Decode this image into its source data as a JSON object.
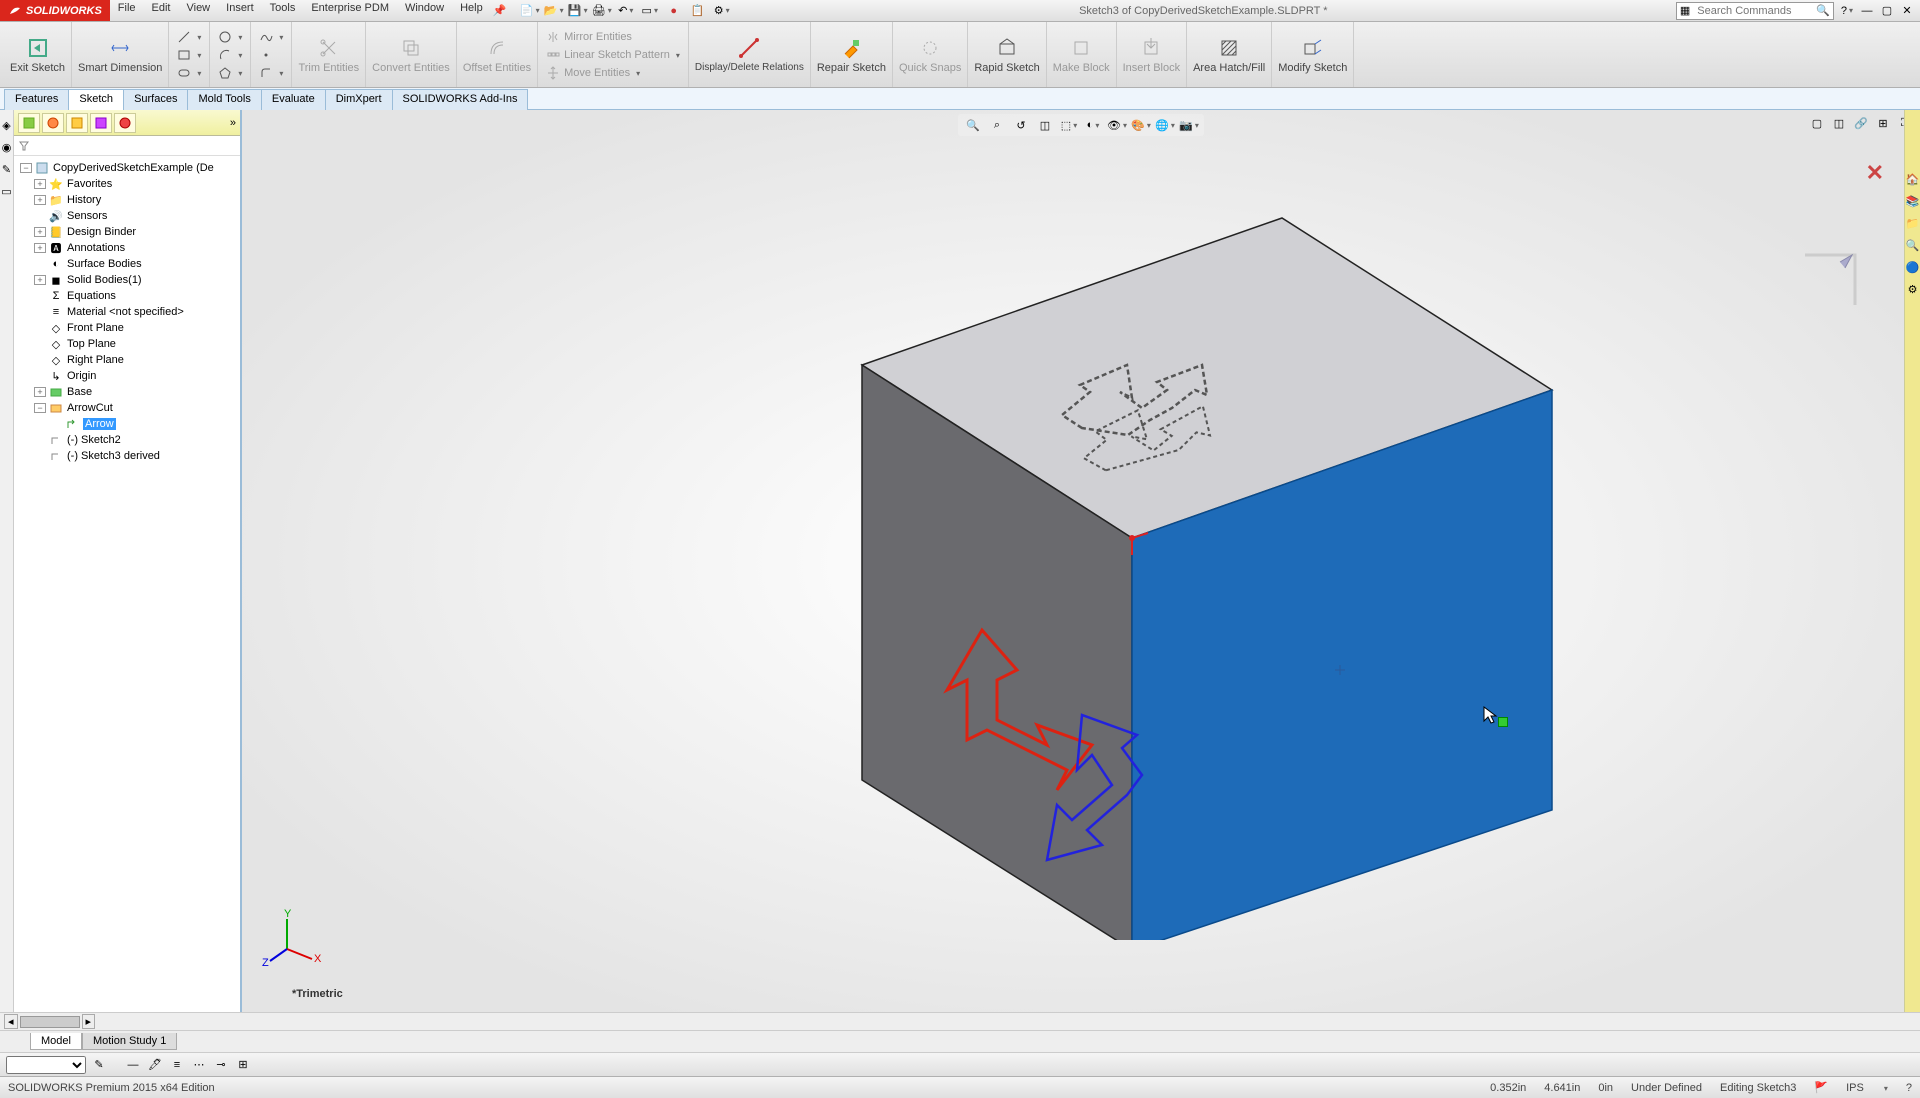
{
  "app_name": "SOLIDWORKS",
  "document_title": "Sketch3 of CopyDerivedSketchExample.SLDPRT *",
  "search_placeholder": "Search Commands",
  "menus": [
    "File",
    "Edit",
    "View",
    "Insert",
    "Tools",
    "Enterprise PDM",
    "Window",
    "Help"
  ],
  "ribbon": {
    "exit_sketch": "Exit Sketch",
    "smart_dimension": "Smart Dimension",
    "trim": "Trim Entities",
    "convert": "Convert Entities",
    "offset": "Offset Entities",
    "mirror": "Mirror Entities",
    "linear_pattern": "Linear Sketch Pattern",
    "move": "Move Entities",
    "display_delete": "Display/Delete Relations",
    "repair": "Repair Sketch",
    "quick_snaps": "Quick Snaps",
    "rapid_sketch": "Rapid Sketch",
    "make_block": "Make Block",
    "insert_block": "Insert Block",
    "area_hatch": "Area Hatch/Fill",
    "modify_sketch": "Modify Sketch"
  },
  "tabs": [
    "Features",
    "Sketch",
    "Surfaces",
    "Mold Tools",
    "Evaluate",
    "DimXpert",
    "SOLIDWORKS Add-Ins"
  ],
  "active_tab": "Sketch",
  "tree": {
    "root": "CopyDerivedSketchExample (De",
    "favorites": "Favorites",
    "history": "History",
    "sensors": "Sensors",
    "design_binder": "Design Binder",
    "annotations": "Annotations",
    "surface_bodies": "Surface Bodies",
    "solid_bodies": "Solid Bodies(1)",
    "equations": "Equations",
    "material": "Material <not specified>",
    "front_plane": "Front Plane",
    "top_plane": "Top Plane",
    "right_plane": "Right Plane",
    "origin": "Origin",
    "base": "Base",
    "arrowcut": "ArrowCut",
    "arrow": "Arrow",
    "sketch2": "(-) Sketch2",
    "sketch3_derived": "(-) Sketch3 derived"
  },
  "view_orientation": "*Trimetric",
  "bottom_tabs": [
    "Model",
    "Motion Study 1"
  ],
  "status": {
    "edition": "SOLIDWORKS Premium 2015 x64 Edition",
    "x": "0.352in",
    "y": "4.641in",
    "z": "0in",
    "state": "Under Defined",
    "mode": "Editing Sketch3",
    "units": "IPS"
  }
}
